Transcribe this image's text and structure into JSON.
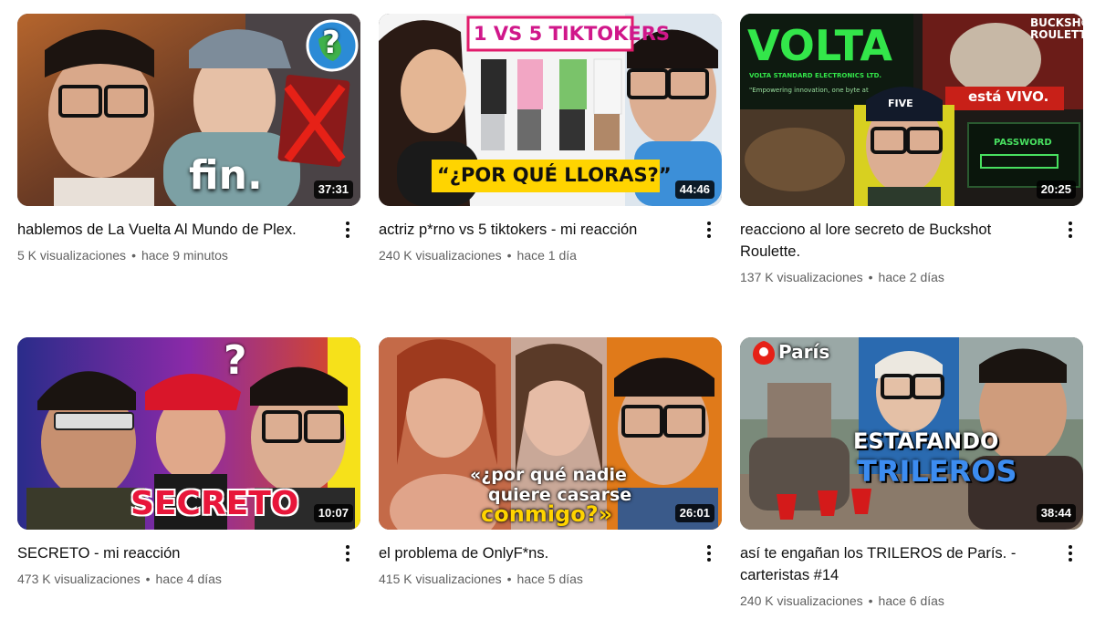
{
  "videos": [
    {
      "title": "hablemos de La Vuelta Al Mundo de Plex.",
      "views": "5 K visualizaciones",
      "age": "hace 9 minutos",
      "duration": "37:31",
      "thumb_text": "fin."
    },
    {
      "title": "actriz p*rno vs 5 tiktokers - mi reacción",
      "views": "240 K visualizaciones",
      "age": "hace 1 día",
      "duration": "44:46",
      "thumb_text_top": "1 VS 5 TIKTOKERS",
      "thumb_text": "“¿POR QUÉ LLORAS?”"
    },
    {
      "title": "reacciono al lore secreto de Buckshot Roulette.",
      "views": "137 K visualizaciones",
      "age": "hace 2 días",
      "duration": "20:25",
      "thumb_text_top": "VOLTA",
      "thumb_text_sub": "VOLTA STANDARD ELECTRONICS LTD.",
      "thumb_text_tag": "\"Empowering innovation, one byte at",
      "thumb_text_logo": "BUCKSHOT ROULETTE",
      "thumb_text_alive": "está VIVO.",
      "thumb_text_pw": "PASSWORD",
      "thumb_text_cap": "FIVE"
    },
    {
      "title": "SECRETO - mi reacción",
      "views": "473 K visualizaciones",
      "age": "hace 4 días",
      "duration": "10:07",
      "thumb_text": "SECRETO"
    },
    {
      "title": "el problema de OnlyF*ns.",
      "views": "415 K visualizaciones",
      "age": "hace 5 días",
      "duration": "26:01",
      "thumb_text_1": "«¿por qué nadie",
      "thumb_text_2": "quiere casarse",
      "thumb_text_3": "conmigo?»"
    },
    {
      "title": "así te engañan los TRILEROS de París. - carteristas #14",
      "views": "240 K visualizaciones",
      "age": "hace 6 días",
      "duration": "38:44",
      "thumb_text_place": "París",
      "thumb_text_1": "ESTAFANDO",
      "thumb_text_2": "TRILEROS"
    }
  ],
  "separator": "•",
  "colors": {
    "title": "#0f0f0f",
    "meta": "#606060",
    "red": "#e62117",
    "yellow": "#ffd400"
  },
  "icons": {
    "more": "vertical-ellipsis-icon"
  }
}
